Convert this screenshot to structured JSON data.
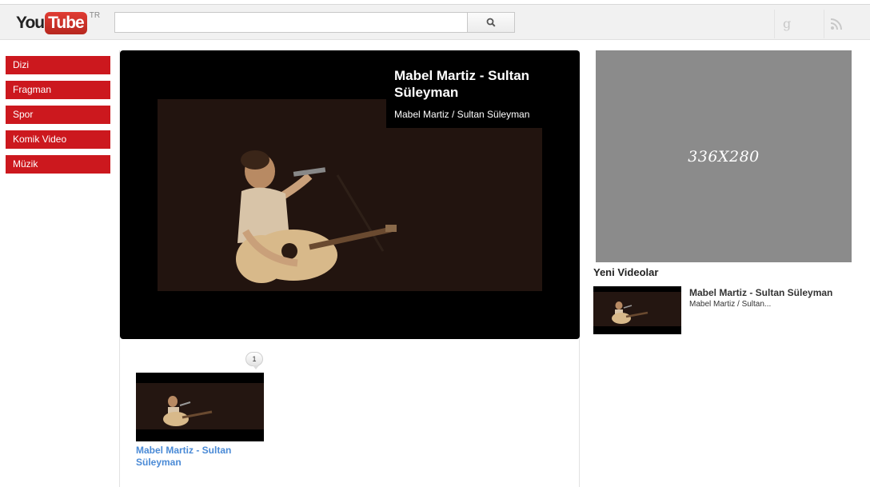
{
  "header": {
    "logo_you": "You",
    "logo_tube": "Tube",
    "logo_region": "TR",
    "search_placeholder": "",
    "search_value": ""
  },
  "sidebar": {
    "items": [
      {
        "label": "Dizi"
      },
      {
        "label": "Fragman"
      },
      {
        "label": "Spor"
      },
      {
        "label": "Komik Video"
      },
      {
        "label": "Müzik"
      }
    ]
  },
  "player": {
    "title": "Mabel Martiz - Sultan Süleyman",
    "subtitle": "Mabel Martiz / Sultan Süleyman"
  },
  "video_list": {
    "count_badge": "1",
    "items": [
      {
        "title": "Mabel Martiz - Sultan Süleyman"
      }
    ]
  },
  "ad": {
    "label": "336X280"
  },
  "recent": {
    "heading": "Yeni Videolar",
    "items": [
      {
        "title": "Mabel Martiz - Sultan Süleyman",
        "subtitle": "Mabel Martiz / Sultan..."
      }
    ]
  },
  "colors": {
    "brand_red": "#cc181e",
    "link_blue": "#4a8ad6",
    "header_bg": "#f1f1f1",
    "ad_gray": "#8b8b8b"
  },
  "icons": [
    "search-icon",
    "google-plus-icon",
    "rss-icon"
  ]
}
